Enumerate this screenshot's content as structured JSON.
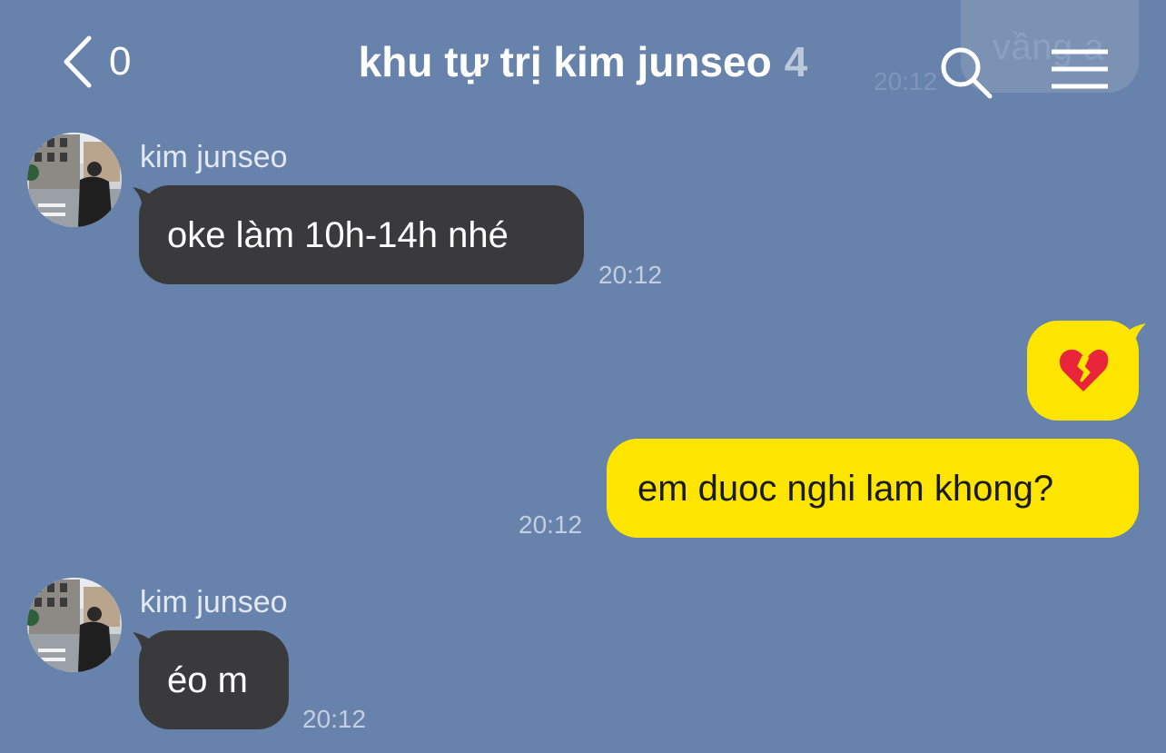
{
  "header": {
    "back_count": "0",
    "title": "khu tự trị kim junseo",
    "member_count": "4"
  },
  "background_preview": {
    "text": "vầng a",
    "time": "20:12"
  },
  "messages": [
    {
      "direction": "incoming",
      "sender": "kim junseo",
      "text": "oke làm 10h-14h nhé",
      "time": "20:12"
    },
    {
      "direction": "outgoing",
      "emoji": "broken-heart-icon"
    },
    {
      "direction": "outgoing",
      "text": "em duoc nghi lam khong?",
      "time": "20:12"
    },
    {
      "direction": "incoming",
      "sender": "kim junseo",
      "text": "éo m",
      "time": "20:12"
    }
  ],
  "colors": {
    "background": "#6782ab",
    "incoming_bubble": "#3a3a3c",
    "outgoing_bubble": "#fee500"
  }
}
